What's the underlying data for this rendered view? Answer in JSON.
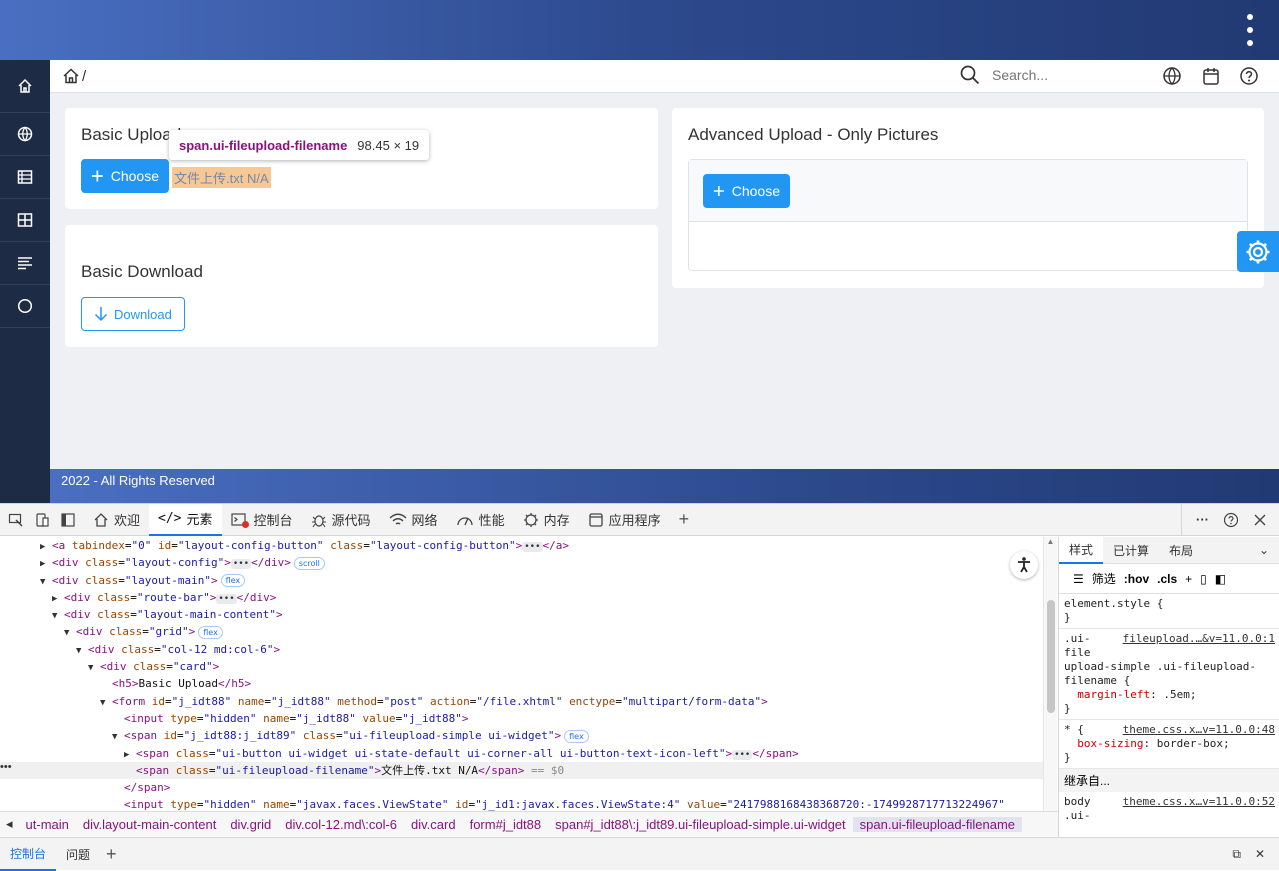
{
  "breadcrumb": {
    "separator": "/"
  },
  "search": {
    "placeholder": "Search..."
  },
  "cards": {
    "basic_upload": {
      "title": "Basic Upload",
      "choose_label": "Choose",
      "filename": "文件上传.txt N/A"
    },
    "basic_download": {
      "title": "Basic Download",
      "download_label": "Download"
    },
    "advanced_upload": {
      "title": "Advanced Upload - Only Pictures",
      "choose_label": "Choose"
    }
  },
  "inspect_tooltip": {
    "selector": "span.ui-fileupload-filename",
    "size": "98.45 × 19"
  },
  "footer": {
    "text": "2022 - All Rights Reserved"
  },
  "devtools": {
    "tabs": [
      "欢迎",
      "元素",
      "控制台",
      "源代码",
      "网络",
      "性能",
      "内存",
      "应用程序"
    ],
    "active_tab": "元素",
    "dom_lines": [
      {
        "indent": 3,
        "tri": "▶",
        "html": "<span class=\"tag\">&lt;a</span> <span class=\"attr\">tabindex</span>=<span class=\"val\">\"0\"</span> <span class=\"attr\">id</span>=<span class=\"val\">\"layout-config-button\"</span> <span class=\"attr\">class</span>=<span class=\"val\">\"layout-config-button\"</span><span class=\"tag\">&gt;</span><span class=\"dots\">•••</span><span class=\"tag\">&lt;/a&gt;</span>"
      },
      {
        "indent": 3,
        "tri": "▶",
        "html": "<span class=\"tag\">&lt;div</span> <span class=\"attr\">class</span>=<span class=\"val\">\"layout-config\"</span><span class=\"tag\">&gt;</span><span class=\"dots\">•••</span><span class=\"tag\">&lt;/div&gt;</span><span class=\"pill\">scroll</span>"
      },
      {
        "indent": 3,
        "tri": "▼",
        "html": "<span class=\"tag\">&lt;div</span> <span class=\"attr\">class</span>=<span class=\"val\">\"layout-main\"</span><span class=\"tag\">&gt;</span><span class=\"pill\">flex</span>"
      },
      {
        "indent": 4,
        "tri": "▶",
        "html": "<span class=\"tag\">&lt;div</span> <span class=\"attr\">class</span>=<span class=\"val\">\"route-bar\"</span><span class=\"tag\">&gt;</span><span class=\"dots\">•••</span><span class=\"tag\">&lt;/div&gt;</span>"
      },
      {
        "indent": 4,
        "tri": "▼",
        "html": "<span class=\"tag\">&lt;div</span> <span class=\"attr\">class</span>=<span class=\"val\">\"layout-main-content\"</span><span class=\"tag\">&gt;</span>"
      },
      {
        "indent": 5,
        "tri": "▼",
        "html": "<span class=\"tag\">&lt;div</span> <span class=\"attr\">class</span>=<span class=\"val\">\"grid\"</span><span class=\"tag\">&gt;</span><span class=\"pill\">flex</span>"
      },
      {
        "indent": 6,
        "tri": "▼",
        "html": "<span class=\"tag\">&lt;div</span> <span class=\"attr\">class</span>=<span class=\"val\">\"col-12 md:col-6\"</span><span class=\"tag\">&gt;</span>"
      },
      {
        "indent": 7,
        "tri": "▼",
        "html": "<span class=\"tag\">&lt;div</span> <span class=\"attr\">class</span>=<span class=\"val\">\"card\"</span><span class=\"tag\">&gt;</span>"
      },
      {
        "indent": 8,
        "tri": "",
        "html": "<span class=\"tag\">&lt;h5&gt;</span><span class=\"txt\">Basic Upload</span><span class=\"tag\">&lt;/h5&gt;</span>"
      },
      {
        "indent": 8,
        "tri": "▼",
        "html": "<span class=\"tag\">&lt;form</span> <span class=\"attr\">id</span>=<span class=\"val\">\"j_idt88\"</span> <span class=\"attr\">name</span>=<span class=\"val\">\"j_idt88\"</span> <span class=\"attr\">method</span>=<span class=\"val\">\"post\"</span> <span class=\"attr\">action</span>=<span class=\"val\">\"/file.xhtml\"</span> <span class=\"attr\">enctype</span>=<span class=\"val\">\"multipart/form-data\"</span><span class=\"tag\">&gt;</span>"
      },
      {
        "indent": 9,
        "tri": "",
        "html": "<span class=\"tag\">&lt;input</span> <span class=\"attr\">type</span>=<span class=\"val\">\"hidden\"</span> <span class=\"attr\">name</span>=<span class=\"val\">\"j_idt88\"</span> <span class=\"attr\">value</span>=<span class=\"val\">\"j_idt88\"</span><span class=\"tag\">&gt;</span>"
      },
      {
        "indent": 9,
        "tri": "▼",
        "html": "<span class=\"tag\">&lt;span</span> <span class=\"attr\">id</span>=<span class=\"val\">\"j_idt88:j_idt89\"</span> <span class=\"attr\">class</span>=<span class=\"val\">\"ui-fileupload-simple ui-widget\"</span><span class=\"tag\">&gt;</span><span class=\"pill\">flex</span>"
      },
      {
        "indent": 10,
        "tri": "▶",
        "html": "<span class=\"tag\">&lt;span</span> <span class=\"attr\">class</span>=<span class=\"val\">\"ui-button ui-widget ui-state-default ui-corner-all ui-button-text-icon-left\"</span><span class=\"tag\">&gt;</span><span class=\"dots\">•••</span><span class=\"tag\">&lt;/span&gt;</span>"
      },
      {
        "indent": 10,
        "tri": "",
        "sel": true,
        "html": "<span class=\"tag\">&lt;span</span> <span class=\"attr\">class</span>=<span class=\"val\">\"ui-fileupload-filename\"</span><span class=\"tag\">&gt;</span><span class=\"txt\">文件上传.txt N/A</span><span class=\"tag\">&lt;/span&gt;</span> <span class=\"cm\">== $0</span>"
      },
      {
        "indent": 9,
        "tri": "",
        "html": "<span class=\"tag\">&lt;/span&gt;</span>"
      },
      {
        "indent": 9,
        "tri": "",
        "html": "<span class=\"tag\">&lt;input</span> <span class=\"attr\">type</span>=<span class=\"val\">\"hidden\"</span> <span class=\"attr\">name</span>=<span class=\"val\">\"javax.faces.ViewState\"</span> <span class=\"attr\">id</span>=<span class=\"val\">\"j_id1:javax.faces.ViewState:4\"</span> <span class=\"attr\">value</span>=<span class=\"val\">\"2417988168438368720:-1749928717713224967\"</span>"
      }
    ],
    "crumbs": [
      "ut-main",
      "div.layout-main-content",
      "div.grid",
      "div.col-12.md\\:col-6",
      "div.card",
      "form#j_idt88",
      "span#j_idt88\\:j_idt89.ui-fileupload-simple.ui-widget",
      "span.ui-fileupload-filename"
    ],
    "styles_tabs": [
      "样式",
      "已计算",
      "布局"
    ],
    "filter_label": "筛选",
    "hov": ":hov",
    "cls": ".cls",
    "inherited": "继承自...",
    "bottom_tabs": [
      "控制台",
      "问题"
    ]
  },
  "colors": {
    "primary": "#2196f3",
    "sidebar": "#1e2b44",
    "tag": "#881280",
    "attr": "#994500",
    "value": "#1a1aa6"
  }
}
